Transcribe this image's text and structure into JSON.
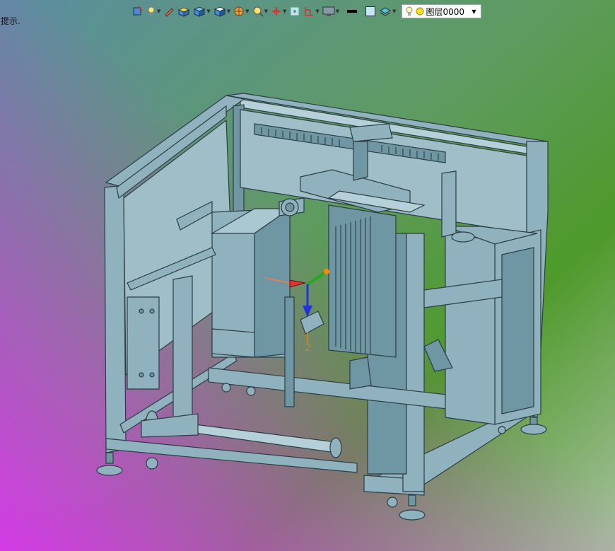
{
  "hint_text": "提示.",
  "toolbar": {
    "buttons": [
      {
        "icon": "view-orient-icon",
        "has_dropdown": false
      },
      {
        "icon": "light-icon",
        "has_dropdown": true
      },
      {
        "icon": "pen-icon",
        "has_dropdown": false
      },
      {
        "icon": "solid-box-icon",
        "has_dropdown": false
      },
      {
        "icon": "cube-icon",
        "has_dropdown": true
      },
      {
        "icon": "cube-section-icon",
        "has_dropdown": true
      },
      {
        "icon": "ball-icon",
        "has_dropdown": true
      },
      {
        "icon": "zoom-icon",
        "has_dropdown": true
      },
      {
        "icon": "axis-icon",
        "has_dropdown": true
      },
      {
        "icon": "grid-icon",
        "has_dropdown": false
      },
      {
        "icon": "frame-icon",
        "has_dropdown": true
      },
      {
        "icon": "monitor-icon",
        "has_dropdown": true
      },
      {
        "icon": "line-weight-icon",
        "has_dropdown": false
      },
      {
        "icon": "color-square-icon",
        "has_dropdown": false
      },
      {
        "icon": "layer-stack-icon",
        "has_dropdown": true
      }
    ],
    "layer_label": "图层0000"
  },
  "triad": {
    "z_label": "Z"
  },
  "colors": {
    "background_top_left": "#5a8fa0",
    "background_top_right": "#4e9a2a",
    "background_bottom_left": "#d43be6",
    "background_bottom_right": "#a8c0a0",
    "model_fill": "#8fb2be",
    "model_edge": "#2c3d44"
  }
}
